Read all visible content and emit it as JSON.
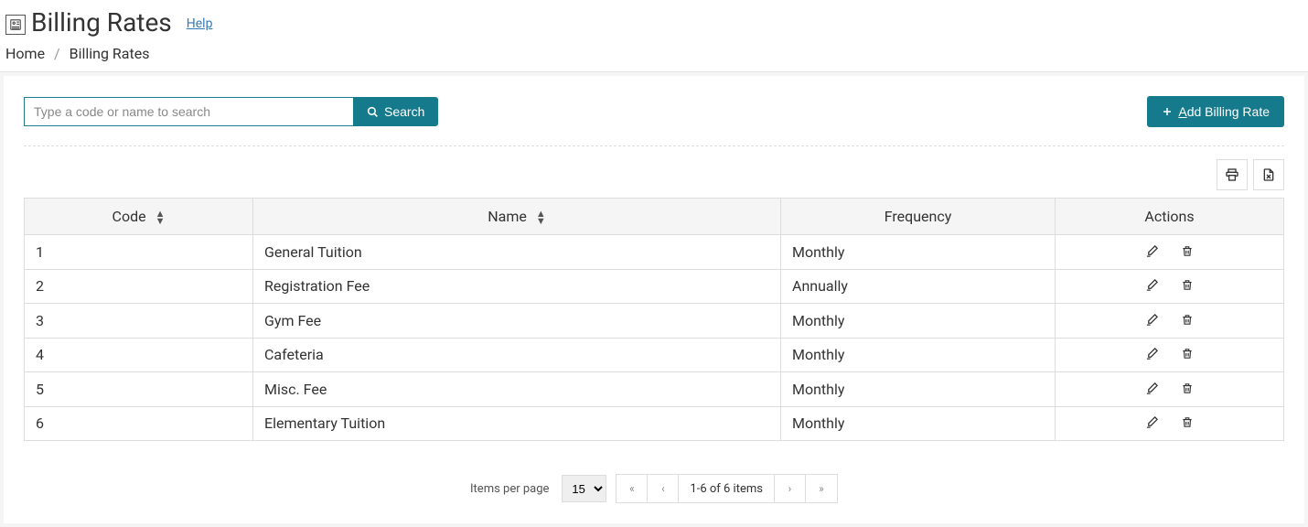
{
  "header": {
    "title": "Billing Rates",
    "help_label": "Help"
  },
  "breadcrumb": {
    "home": "Home",
    "current": "Billing Rates"
  },
  "toolbar": {
    "search_placeholder": "Type a code or name to search",
    "search_button": "Search",
    "add_button_prefix": "A",
    "add_button_rest": "dd Billing Rate"
  },
  "table": {
    "columns": {
      "code": "Code",
      "name": "Name",
      "frequency": "Frequency",
      "actions": "Actions"
    },
    "rows": [
      {
        "code": "1",
        "name": "General Tuition",
        "frequency": "Monthly"
      },
      {
        "code": "2",
        "name": "Registration Fee",
        "frequency": "Annually"
      },
      {
        "code": "3",
        "name": "Gym Fee",
        "frequency": "Monthly"
      },
      {
        "code": "4",
        "name": "Cafeteria",
        "frequency": "Monthly"
      },
      {
        "code": "5",
        "name": "Misc. Fee",
        "frequency": "Monthly"
      },
      {
        "code": "6",
        "name": "Elementary Tuition",
        "frequency": "Monthly"
      }
    ]
  },
  "pager": {
    "items_per_page_label": "Items per page",
    "items_per_page_value": "15",
    "range_text": "1-6 of 6 items"
  }
}
